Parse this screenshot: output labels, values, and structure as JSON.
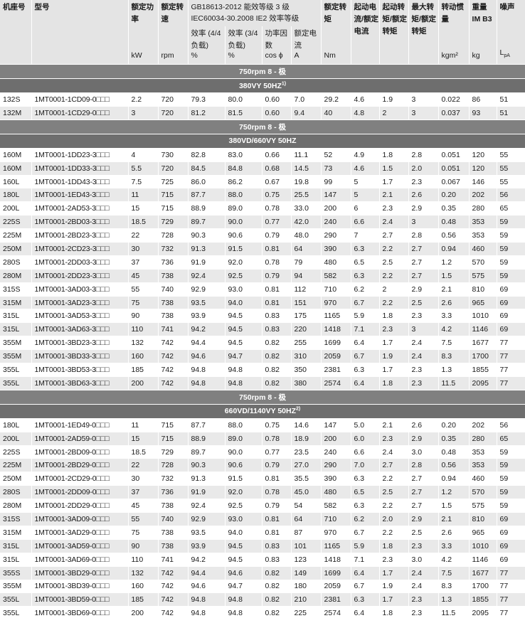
{
  "header": {
    "frame": "机座号",
    "model": "型号",
    "power": "额定功率",
    "power_unit": "kW",
    "speed": "额定转速",
    "speed_unit": "rpm",
    "standard": "GB18613-2012 能效等级 3 级 IEC60034-30.2008 IE2 效率等级",
    "eff_44": "效率 (4/4 负载)",
    "eff_44_unit": "%",
    "eff_34": "效率 (3/4 负载)",
    "eff_34_unit": "%",
    "pf": "功率因数",
    "pf_unit": "cos ϕ",
    "current": "额定电流",
    "current_unit": "A",
    "torque": "额定转矩",
    "torque_unit": "Nm",
    "start_current": "起动电流/额定电流",
    "start_torque": "起动转矩/额定转矩",
    "max_torque": "最大转矩/额定转矩",
    "inertia": "转动惯量",
    "inertia_unit": "kgm²",
    "weight": "重量 IM B3",
    "weight_unit": "kg",
    "noise": "噪声",
    "noise_unit": "L",
    "noise_unit_sub": "pA"
  },
  "sections": [
    {
      "title": "750rpm 8 - 极",
      "subtitle": "380VY  50HZ",
      "note": "1)",
      "rows": [
        [
          "132S",
          "1MT0001-1CD09-0□□□",
          "2.2",
          "720",
          "79.3",
          "80.0",
          "0.60",
          "7.0",
          "29.2",
          "4.6",
          "1.9",
          "3",
          "0.022",
          "86",
          "51"
        ],
        [
          "132M",
          "1MT0001-1CD29-0□□□",
          "3",
          "720",
          "81.2",
          "81.5",
          "0.60",
          "9.4",
          "40",
          "4.8",
          "2",
          "3",
          "0.037",
          "93",
          "51"
        ]
      ]
    },
    {
      "title": "750rpm 8 - 极",
      "subtitle": "380VD/660VY 50HZ",
      "note": "",
      "rows": [
        [
          "160M",
          "1MT0001-1DD23-3□□□",
          "4",
          "730",
          "82.8",
          "83.0",
          "0.66",
          "11.1",
          "52",
          "4.9",
          "1.8",
          "2.8",
          "0.051",
          "120",
          "55"
        ],
        [
          "160M",
          "1MT0001-1DD33-3□□□",
          "5.5",
          "720",
          "84.5",
          "84.8",
          "0.68",
          "14.5",
          "73",
          "4.6",
          "1.5",
          "2.0",
          "0.051",
          "120",
          "55"
        ],
        [
          "160L",
          "1MT0001-1DD43-3□□□",
          "7.5",
          "725",
          "86.0",
          "86.2",
          "0.67",
          "19.8",
          "99",
          "5",
          "1.7",
          "2.3",
          "0.067",
          "146",
          "55"
        ],
        [
          "180L",
          "1MT0001-1ED43-3□□□",
          "11",
          "715",
          "87.7",
          "88.0",
          "0.75",
          "25.5",
          "147",
          "5",
          "2.1",
          "2.6",
          "0.20",
          "202",
          "56"
        ],
        [
          "200L",
          "1MT0001-2AD53-3□□□",
          "15",
          "715",
          "88.9",
          "89.0",
          "0.78",
          "33.0",
          "200",
          "6",
          "2.3",
          "2.9",
          "0.35",
          "280",
          "65"
        ],
        [
          "225S",
          "1MT0001-2BD03-3□□□",
          "18.5",
          "729",
          "89.7",
          "90.0",
          "0.77",
          "42.0",
          "240",
          "6.6",
          "2.4",
          "3",
          "0.48",
          "353",
          "59"
        ],
        [
          "225M",
          "1MT0001-2BD23-3□□□",
          "22",
          "728",
          "90.3",
          "90.6",
          "0.79",
          "48.0",
          "290",
          "7",
          "2.7",
          "2.8",
          "0.56",
          "353",
          "59"
        ],
        [
          "250M",
          "1MT0001-2CD23-3□□□",
          "30",
          "732",
          "91.3",
          "91.5",
          "0.81",
          "64",
          "390",
          "6.3",
          "2.2",
          "2.7",
          "0.94",
          "460",
          "59"
        ],
        [
          "280S",
          "1MT0001-2DD03-3□□□",
          "37",
          "736",
          "91.9",
          "92.0",
          "0.78",
          "79",
          "480",
          "6.5",
          "2.5",
          "2.7",
          "1.2",
          "570",
          "59"
        ],
        [
          "280M",
          "1MT0001-2DD23-3□□□",
          "45",
          "738",
          "92.4",
          "92.5",
          "0.79",
          "94",
          "582",
          "6.3",
          "2.2",
          "2.7",
          "1.5",
          "575",
          "59"
        ],
        [
          "315S",
          "1MT0001-3AD03-3□□□",
          "55",
          "740",
          "92.9",
          "93.0",
          "0.81",
          "112",
          "710",
          "6.2",
          "2",
          "2.9",
          "2.1",
          "810",
          "69"
        ],
        [
          "315M",
          "1MT0001-3AD23-3□□□",
          "75",
          "738",
          "93.5",
          "94.0",
          "0.81",
          "151",
          "970",
          "6.7",
          "2.2",
          "2.5",
          "2.6",
          "965",
          "69"
        ],
        [
          "315L",
          "1MT0001-3AD53-3□□□",
          "90",
          "738",
          "93.9",
          "94.5",
          "0.83",
          "175",
          "1165",
          "5.9",
          "1.8",
          "2.3",
          "3.3",
          "1010",
          "69"
        ],
        [
          "315L",
          "1MT0001-3AD63-3□□□",
          "110",
          "741",
          "94.2",
          "94.5",
          "0.83",
          "220",
          "1418",
          "7.1",
          "2.3",
          "3",
          "4.2",
          "1146",
          "69"
        ],
        [
          "355M",
          "1MT0001-3BD23-3□□□",
          "132",
          "742",
          "94.4",
          "94.5",
          "0.82",
          "255",
          "1699",
          "6.4",
          "1.7",
          "2.4",
          "7.5",
          "1677",
          "77"
        ],
        [
          "355M",
          "1MT0001-3BD33-3□□□",
          "160",
          "742",
          "94.6",
          "94.7",
          "0.82",
          "310",
          "2059",
          "6.7",
          "1.9",
          "2.4",
          "8.3",
          "1700",
          "77"
        ],
        [
          "355L",
          "1MT0001-3BD53-3□□□",
          "185",
          "742",
          "94.8",
          "94.8",
          "0.82",
          "350",
          "2381",
          "6.3",
          "1.7",
          "2.3",
          "1.3",
          "1855",
          "77"
        ],
        [
          "355L",
          "1MT0001-3BD63-3□□□",
          "200",
          "742",
          "94.8",
          "94.8",
          "0.82",
          "380",
          "2574",
          "6.4",
          "1.8",
          "2.3",
          "11.5",
          "2095",
          "77"
        ]
      ]
    },
    {
      "title": "750rpm 8 - 极",
      "subtitle": "660VD/1140VY 50HZ",
      "note": "2)",
      "rows": [
        [
          "180L",
          "1MT0001-1ED49-0□□□",
          "11",
          "715",
          "87.7",
          "88.0",
          "0.75",
          "14.6",
          "147",
          "5.0",
          "2.1",
          "2.6",
          "0.20",
          "202",
          "56"
        ],
        [
          "200L",
          "1MT0001-2AD59-0□□□",
          "15",
          "715",
          "88.9",
          "89.0",
          "0.78",
          "18.9",
          "200",
          "6.0",
          "2.3",
          "2.9",
          "0.35",
          "280",
          "65"
        ],
        [
          "225S",
          "1MT0001-2BD09-0□□□",
          "18.5",
          "729",
          "89.7",
          "90.0",
          "0.77",
          "23.5",
          "240",
          "6.6",
          "2.4",
          "3.0",
          "0.48",
          "353",
          "59"
        ],
        [
          "225M",
          "1MT0001-2BD29-0□□□",
          "22",
          "728",
          "90.3",
          "90.6",
          "0.79",
          "27.0",
          "290",
          "7.0",
          "2.7",
          "2.8",
          "0.56",
          "353",
          "59"
        ],
        [
          "250M",
          "1MT0001-2CD29-0□□□",
          "30",
          "732",
          "91.3",
          "91.5",
          "0.81",
          "35.5",
          "390",
          "6.3",
          "2.2",
          "2.7",
          "0.94",
          "460",
          "59"
        ],
        [
          "280S",
          "1MT0001-2DD09-0□□□",
          "37",
          "736",
          "91.9",
          "92.0",
          "0.78",
          "45.0",
          "480",
          "6.5",
          "2.5",
          "2.7",
          "1.2",
          "570",
          "59"
        ],
        [
          "280M",
          "1MT0001-2DD29-0□□□",
          "45",
          "738",
          "92.4",
          "92.5",
          "0.79",
          "54",
          "582",
          "6.3",
          "2.2",
          "2.7",
          "1.5",
          "575",
          "59"
        ],
        [
          "315S",
          "1MT0001-3AD09-0□□□",
          "55",
          "740",
          "92.9",
          "93.0",
          "0.81",
          "64",
          "710",
          "6.2",
          "2.0",
          "2.9",
          "2.1",
          "810",
          "69"
        ],
        [
          "315M",
          "1MT0001-3AD29-0□□□",
          "75",
          "738",
          "93.5",
          "94.0",
          "0.81",
          "87",
          "970",
          "6.7",
          "2.2",
          "2.5",
          "2.6",
          "965",
          "69"
        ],
        [
          "315L",
          "1MT0001-3AD59-0□□□",
          "90",
          "738",
          "93.9",
          "94.5",
          "0.83",
          "101",
          "1165",
          "5.9",
          "1.8",
          "2.3",
          "3.3",
          "1010",
          "69"
        ],
        [
          "315L",
          "1MT0001-3AD69-0□□□",
          "110",
          "741",
          "94.2",
          "94.5",
          "0.83",
          "123",
          "1418",
          "7.1",
          "2.3",
          "3.0",
          "4.2",
          "1146",
          "69"
        ],
        [
          "355S",
          "1MT0001-3BD29-0□□□",
          "132",
          "742",
          "94.4",
          "94.6",
          "0.82",
          "149",
          "1699",
          "6.4",
          "1.7",
          "2.4",
          "7.5",
          "1677",
          "77"
        ],
        [
          "355M",
          "1MT0001-3BD39-0□□□",
          "160",
          "742",
          "94.6",
          "94.7",
          "0.82",
          "180",
          "2059",
          "6.7",
          "1.9",
          "2.4",
          "8.3",
          "1700",
          "77"
        ],
        [
          "355L",
          "1MT0001-3BD59-0□□□",
          "185",
          "742",
          "94.8",
          "94.8",
          "0.82",
          "210",
          "2381",
          "6.3",
          "1.7",
          "2.3",
          "1.3",
          "1855",
          "77"
        ],
        [
          "355L",
          "1MT0001-3BD69-0□□□",
          "200",
          "742",
          "94.8",
          "94.8",
          "0.82",
          "225",
          "2574",
          "6.4",
          "1.8",
          "2.3",
          "11.5",
          "2095",
          "77"
        ]
      ]
    }
  ]
}
